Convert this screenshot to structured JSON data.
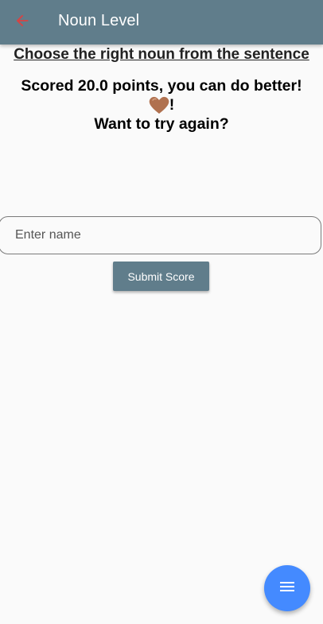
{
  "appbar": {
    "title": "Noun Level",
    "back_icon": "arrow-back-icon",
    "back_icon_color": "#d84343",
    "background": "#607d8b"
  },
  "main": {
    "instruction": "Choose the right noun from the sentence",
    "score_line1": "Scored 20.0 points, you can do better!",
    "score_line2_suffix": "!",
    "heart_icon": "brown-heart-icon",
    "heart_color": "#b0714f",
    "score_line3": "Want to try again?"
  },
  "form": {
    "name_placeholder": "Enter name",
    "name_value": "",
    "submit_label": "Submit Score"
  },
  "fab": {
    "icon": "menu-icon",
    "color": "#448aff"
  }
}
